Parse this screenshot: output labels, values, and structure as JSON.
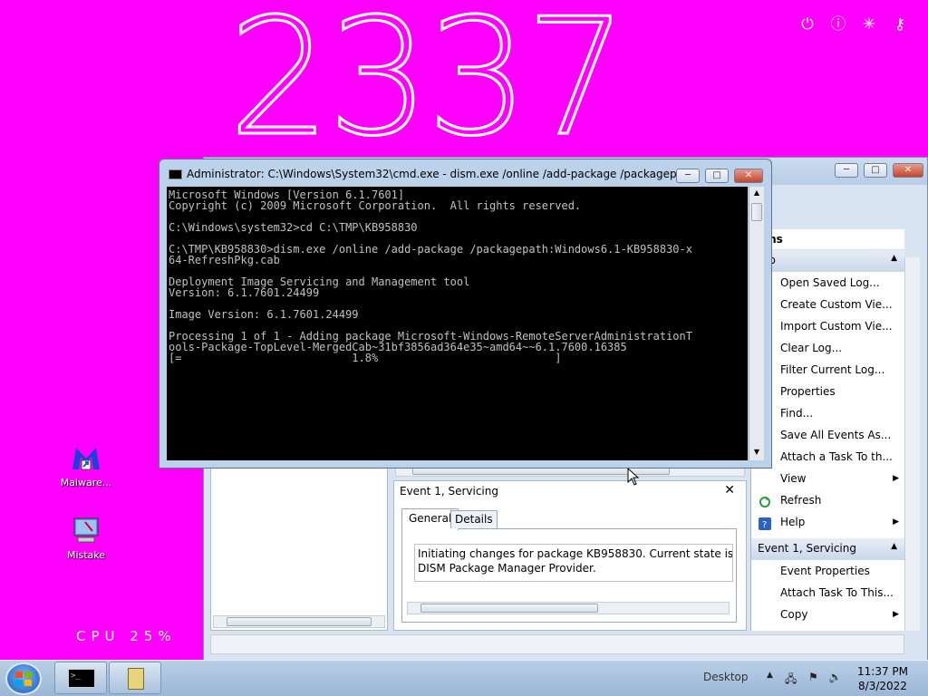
{
  "clock": {
    "time": "2337"
  },
  "top_icons": [
    "power-icon",
    "info-icon",
    "brightness-icon",
    "key-icon"
  ],
  "desktop": {
    "icons": [
      {
        "label": "Malware...",
        "icon": "malwarebytes-icon"
      },
      {
        "label": "Mistake",
        "icon": "computer-icon"
      }
    ],
    "cpu": "CPU 25%"
  },
  "cmd": {
    "title": "Administrator: C:\\Windows\\System32\\cmd.exe - dism.exe  /online /add-package /packagepath:Win...",
    "console": "Microsoft Windows [Version 6.1.7601]\nCopyright (c) 2009 Microsoft Corporation.  All rights reserved.\n\nC:\\Windows\\system32>cd C:\\TMP\\KB958830\n\nC:\\TMP\\KB958830>dism.exe /online /add-package /packagepath:Windows6.1-KB958830-x\n64-RefreshPkg.cab\n\nDeployment Image Servicing and Management tool\nVersion: 6.1.7601.24499\n\nImage Version: 6.1.7601.24499\n\nProcessing 1 of 1 - Adding package Microsoft-Windows-RemoteServerAdministrationT\nools-Package-TopLevel-MergedCab~31bf3856ad364e35~amd64~~6.1.7600.16385\n[=                          1.8%                           ]",
    "progress_percent": 1.8
  },
  "event_viewer": {
    "actions_header": "tions",
    "section_header": "tup",
    "actions": [
      {
        "label": "Open Saved Log...",
        "icon": "open-log-icon"
      },
      {
        "label": "Create Custom Vie...",
        "icon": "filter-icon"
      },
      {
        "label": "Import Custom Vie...",
        "icon": "import-icon"
      },
      {
        "label": "Clear Log...",
        "icon": "clear-icon"
      },
      {
        "label": "Filter Current Log...",
        "icon": "filter-icon"
      },
      {
        "label": "Properties",
        "icon": "properties-icon"
      },
      {
        "label": "Find...",
        "icon": "find-icon"
      },
      {
        "label": "Save All Events As...",
        "icon": "save-icon"
      },
      {
        "label": "Attach a Task To th...",
        "icon": "task-icon"
      },
      {
        "label": "View",
        "icon": "view-icon",
        "submenu": true
      },
      {
        "label": "Refresh",
        "icon": "refresh-icon"
      },
      {
        "label": "Help",
        "icon": "help-icon",
        "submenu": true
      }
    ],
    "event_section": "Event 1, Servicing",
    "event_actions": [
      {
        "label": "Event Properties",
        "icon": "event-properties-icon"
      },
      {
        "label": "Attach Task To This...",
        "icon": "task-icon"
      },
      {
        "label": "Copy",
        "icon": "copy-icon",
        "submenu": true
      }
    ],
    "detail": {
      "title": "Event 1, Servicing",
      "tabs": [
        "General",
        "Details"
      ],
      "message_line1": "Initiating changes for package KB958830. Current state is Abser",
      "message_line2": "DISM Package Manager Provider."
    }
  },
  "taskbar": {
    "desktop_label": "Desktop",
    "time": "11:37 PM",
    "date": "8/3/2022"
  }
}
